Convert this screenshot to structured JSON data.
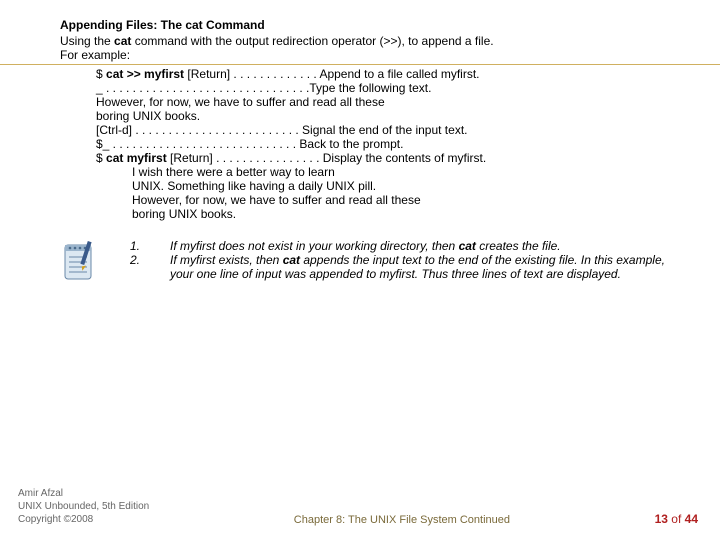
{
  "title": "Appending Files: The cat Command",
  "intro_prefix": "Using the ",
  "intro_bold": "cat",
  "intro_suffix": " command with the output redirection operator (>>), to append a file.",
  "for_example": "For example:",
  "ex1_prefix": "$ ",
  "ex1_bold": "cat >> myfirst",
  "ex1_mid": " [Return] . . . . . . . . . . . . . Append to a file called myfirst.",
  "ex2": "_ . . . . . . . . . . . . . . . . . . . . . . . . . . . . . . .Type the following text.",
  "ex3": "However, for now, we have to suffer and read all these",
  "ex4": "boring UNIX books.",
  "ex5": "[Ctrl-d] . . . . . . . . . . . . . . . . . . . . . . . . .  Signal the end of the input text.",
  "ex6": "$_ . . . . . . . . . . . . . . . . . . . . . . . . . . . . Back to the prompt.",
  "ex7_prefix": "$ ",
  "ex7_bold": "cat myfirst",
  "ex7_mid": " [Return] . . . . . . . . . . . . . . . . Display the contents of myfirst.",
  "out1": "I wish there were a better way to learn",
  "out2": "UNIX. Something like having a daily UNIX pill.",
  "out3": "However, for now, we have to suffer and read all these",
  "out4": "boring UNIX books.",
  "num1": "1.",
  "num2": "2.",
  "note1_a": "If myfirst ",
  "note1_b": "does not exist",
  "note1_c": " in your working directory, then ",
  "note1_d": "cat",
  "note1_e": " creates the file.",
  "note2_a": "If myfirst exists, then ",
  "note2_b": "cat",
  "note2_c": " appends the input text to the end of the existing file. In this example, your one line of input was appended to myfirst. Thus three lines of text are displayed.",
  "footer_author": "Amir Afzal",
  "footer_book": "UNIX Unbounded, 5th Edition",
  "footer_copy": "Copyright ©2008",
  "footer_chapter": "Chapter 8: The UNIX File System Continued",
  "page_cur": "13",
  "page_of": " of ",
  "page_total": "44"
}
